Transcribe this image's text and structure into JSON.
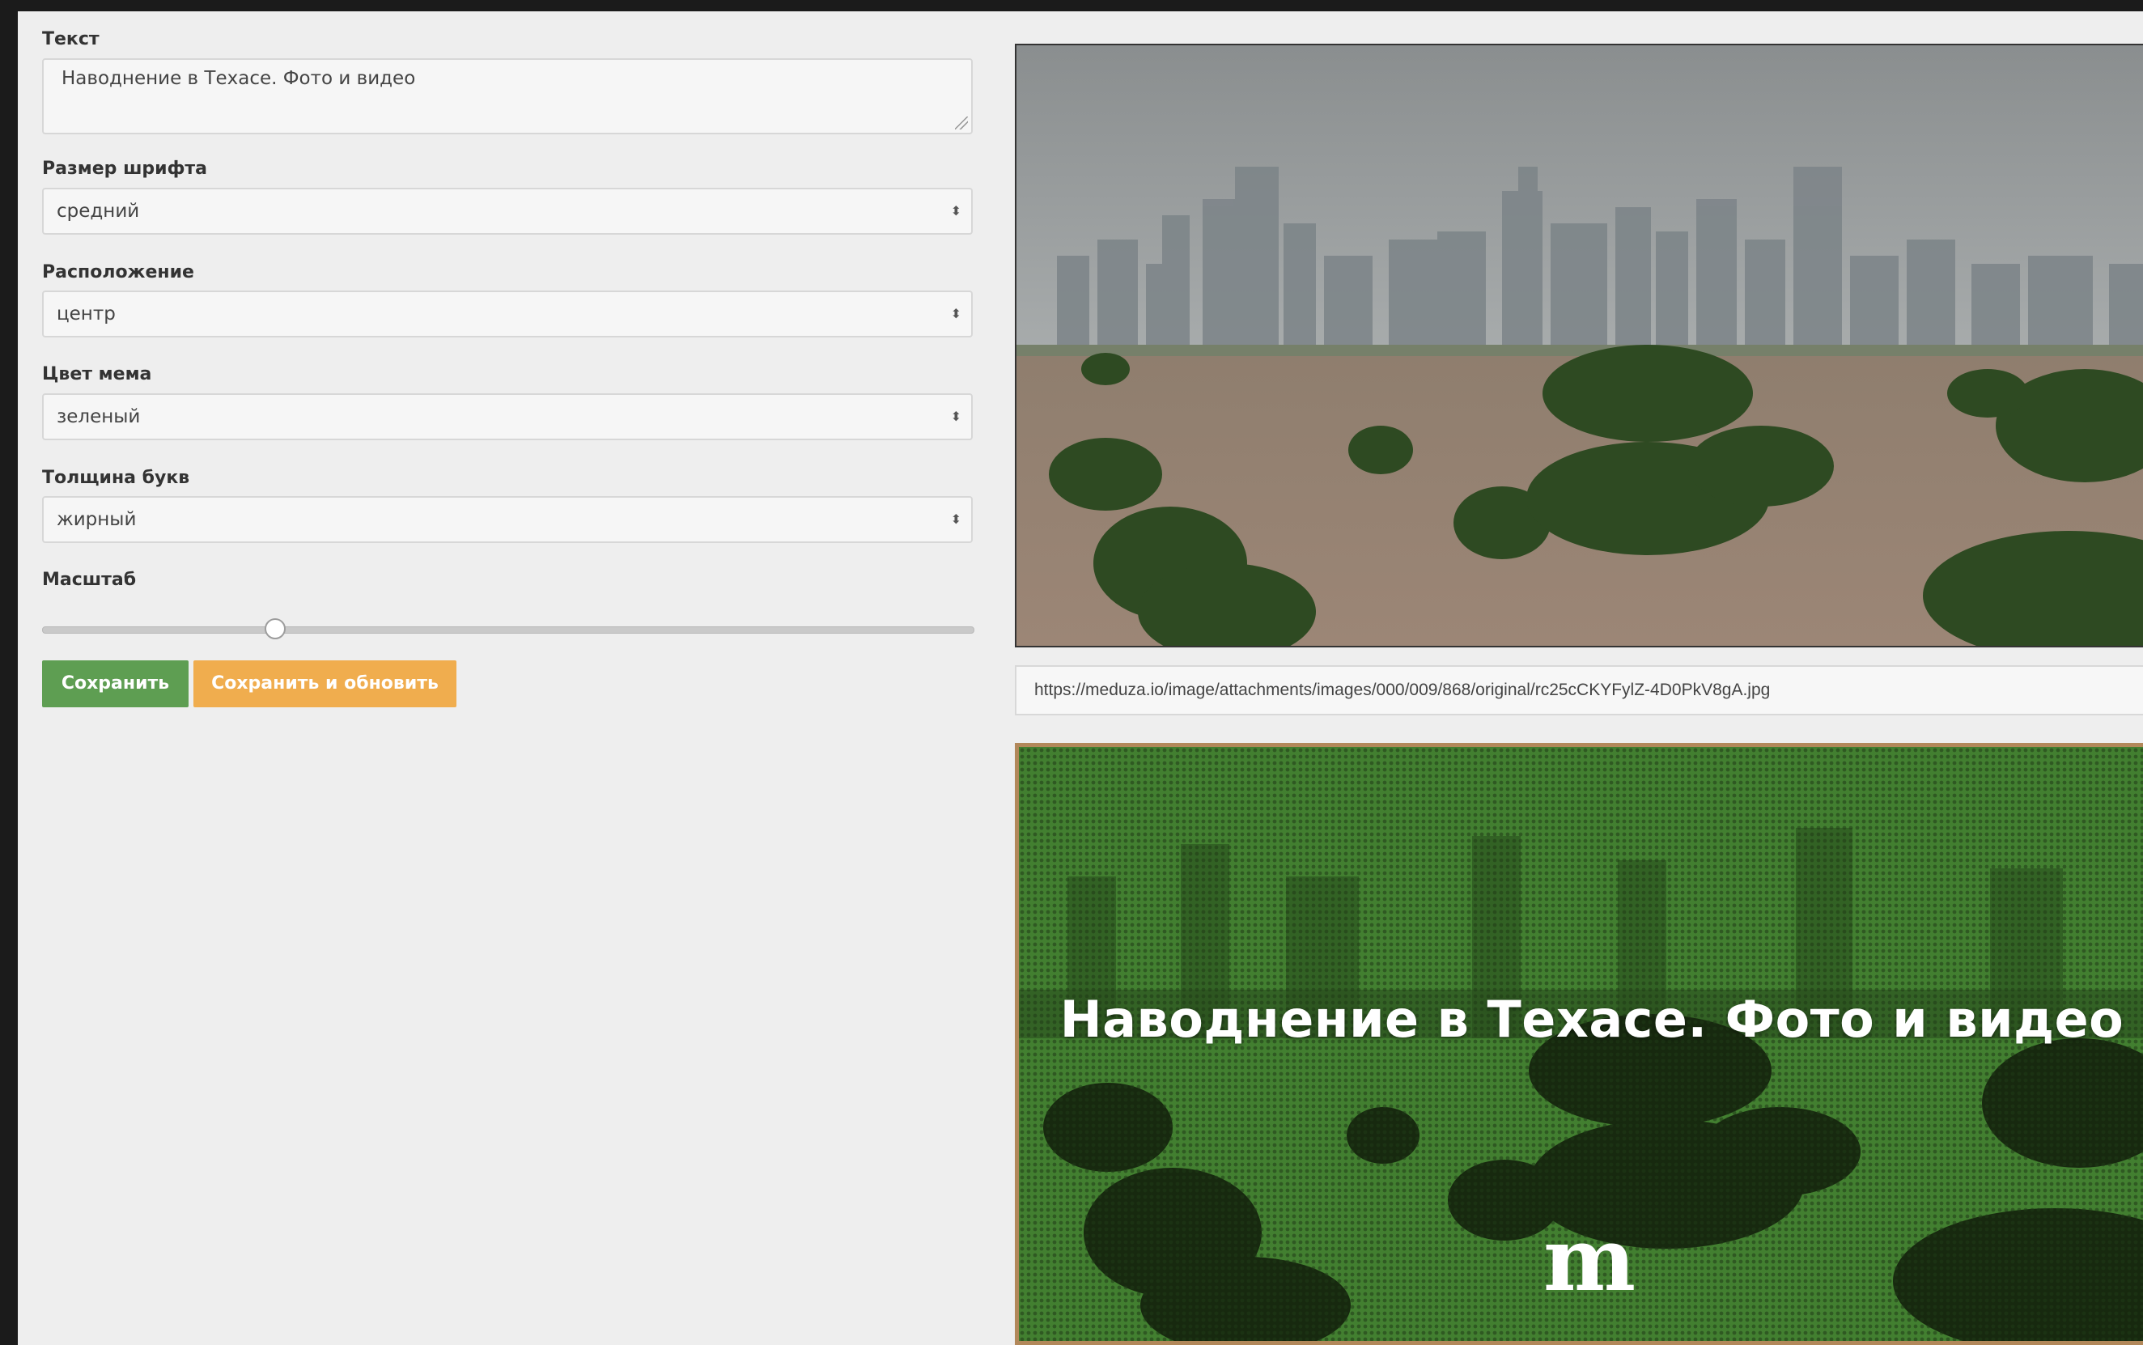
{
  "form": {
    "text_label": "Текст",
    "text_value": "Наводнение в Техасе. Фото и видео",
    "font_size_label": "Размер шрифта",
    "font_size_value": "средний",
    "position_label": "Расположение",
    "position_value": "центр",
    "color_label": "Цвет мема",
    "color_value": "зеленый",
    "weight_label": "Толщина букв",
    "weight_value": "жирный",
    "scale_label": "Масштаб",
    "scale_value_fraction": 0.25,
    "save_button": "Сохранить",
    "save_update_button": "Сохранить и обновить"
  },
  "preview": {
    "image_url": "https://meduza.io/image/attachments/images/000/009/868/original/rc25cCKYFylZ-4D0PkV8gA.jpg",
    "meme_text": "Наводнение в Техасе. Фото и видео",
    "logo_text": "m"
  },
  "colors": {
    "save_green": "#5e9e52",
    "update_orange": "#f0ad4e",
    "meme_green": "#3f7f2e",
    "meme_border": "#b2885a"
  },
  "icons": [
    "select-arrows-icon",
    "resize-grip-icon",
    "meduza-logo-icon"
  ]
}
